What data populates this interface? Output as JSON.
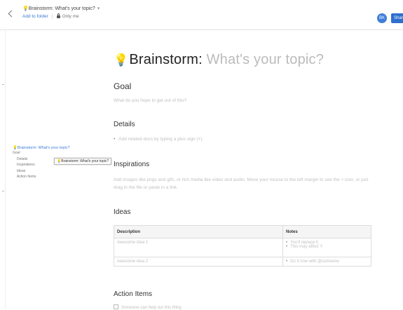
{
  "header": {
    "doc_title": "Brainstorm: What's your topic?",
    "add_to_folder": "Add to folder",
    "visibility": "Only me",
    "avatar_initials": "BK",
    "share_label": "Share"
  },
  "page": {
    "title_main": "Brainstorm:",
    "title_placeholder": "What's your topic?"
  },
  "sections": {
    "goal": {
      "heading": "Goal",
      "hint": "What do you hope to get out of this?"
    },
    "details": {
      "heading": "Details",
      "bullet_hint": "Add related docs by typing a plus sign (+)"
    },
    "inspirations": {
      "heading": "Inspirations",
      "paragraph": "Add images like pngs and gifs, or rich media like video and audio. Move your mouse to the left margin to see the + icon, or just drag in the file or paste in a link."
    },
    "ideas": {
      "heading": "Ideas",
      "columns": [
        "Description",
        "Notes"
      ],
      "rows": [
        {
          "description": "Awesome idea 1",
          "notes": [
            "You'll replace it",
            "This may affect Y"
          ]
        },
        {
          "description": "Awesome idea 2",
          "notes": [
            "Do it now with @someone"
          ]
        }
      ]
    },
    "action_items": {
      "heading": "Action Items",
      "first_item": "Someone can help out this thing"
    }
  },
  "toc": {
    "title": "Brainstorm: What's your topic?",
    "items": [
      {
        "label": "Goal",
        "level": 0
      },
      {
        "label": "Details",
        "level": 1
      },
      {
        "label": "Inspirations",
        "level": 1
      },
      {
        "label": "Ideas",
        "level": 1
      },
      {
        "label": "Action Items",
        "level": 1
      }
    ],
    "tooltip": "Brainstorm: What's your topic?"
  },
  "colors": {
    "accent": "#3b7bd8",
    "bulb": "#f5b400",
    "share_button": "#2f6fcf"
  },
  "icons": {
    "back": "chevron-left-icon",
    "bulb": "lightbulb-icon",
    "lock": "lock-icon",
    "caret": "chevron-down-icon"
  }
}
